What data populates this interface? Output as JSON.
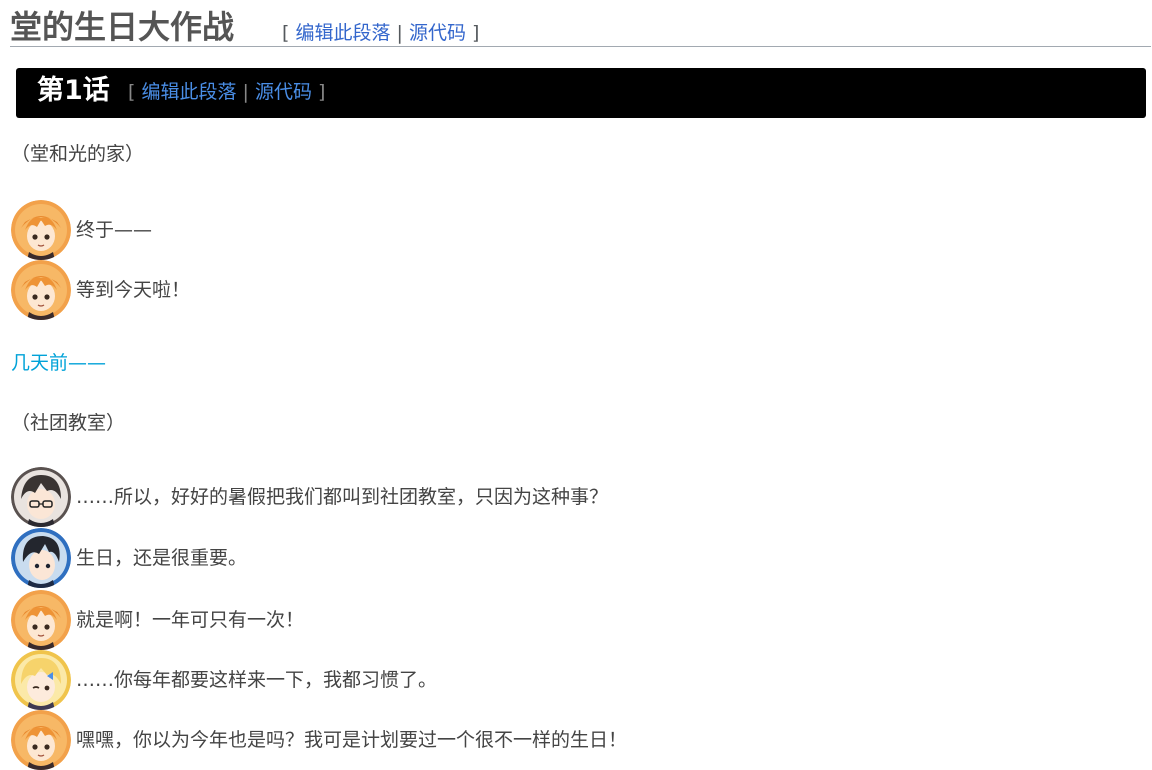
{
  "page": {
    "title": "堂的生日大作战",
    "edit_bracket_open": "[",
    "edit_link": "编辑此段落",
    "separator": "|",
    "source_link": "源代码",
    "edit_bracket_close": "]"
  },
  "section": {
    "title": "第1话",
    "edit_bracket_open": "[",
    "edit_link": "编辑此段落",
    "separator": "|",
    "source_link": "源代码",
    "edit_bracket_close": "]"
  },
  "scene1": "（堂和光的家）",
  "dialogues_a": [
    {
      "avatar": "orange-hair-girl-avatar",
      "text": "终于——"
    },
    {
      "avatar": "orange-hair-girl-avatar",
      "text": "等到今天啦！"
    }
  ],
  "flashback": "几天前——",
  "scene2": "（社团教室）",
  "dialogues_b": [
    {
      "avatar": "dark-hair-glasses-boy-avatar",
      "text": "……所以，好好的暑假把我们都叫到社团教室，只因为这种事？"
    },
    {
      "avatar": "black-hair-boy-avatar",
      "text": "生日，还是很重要。"
    },
    {
      "avatar": "orange-hair-girl-avatar",
      "text": "就是啊！一年可只有一次！"
    },
    {
      "avatar": "blonde-hair-girl-avatar",
      "text": "……你每年都要这样来一下，我都习惯了。"
    },
    {
      "avatar": "orange-hair-girl-avatar",
      "text": "嘿嘿，你以为今年也是吗？我可是计划要过一个很不一样的生日！"
    }
  ],
  "colors": {
    "link": "#3366cc",
    "section_bar": "#000000",
    "flashback_text": "#00a2d8",
    "orange_hair": "#f2a14a",
    "dark_hair": "#3a3432",
    "blue_ring": "#2f6fc0",
    "blonde_hair": "#f6d36b"
  }
}
